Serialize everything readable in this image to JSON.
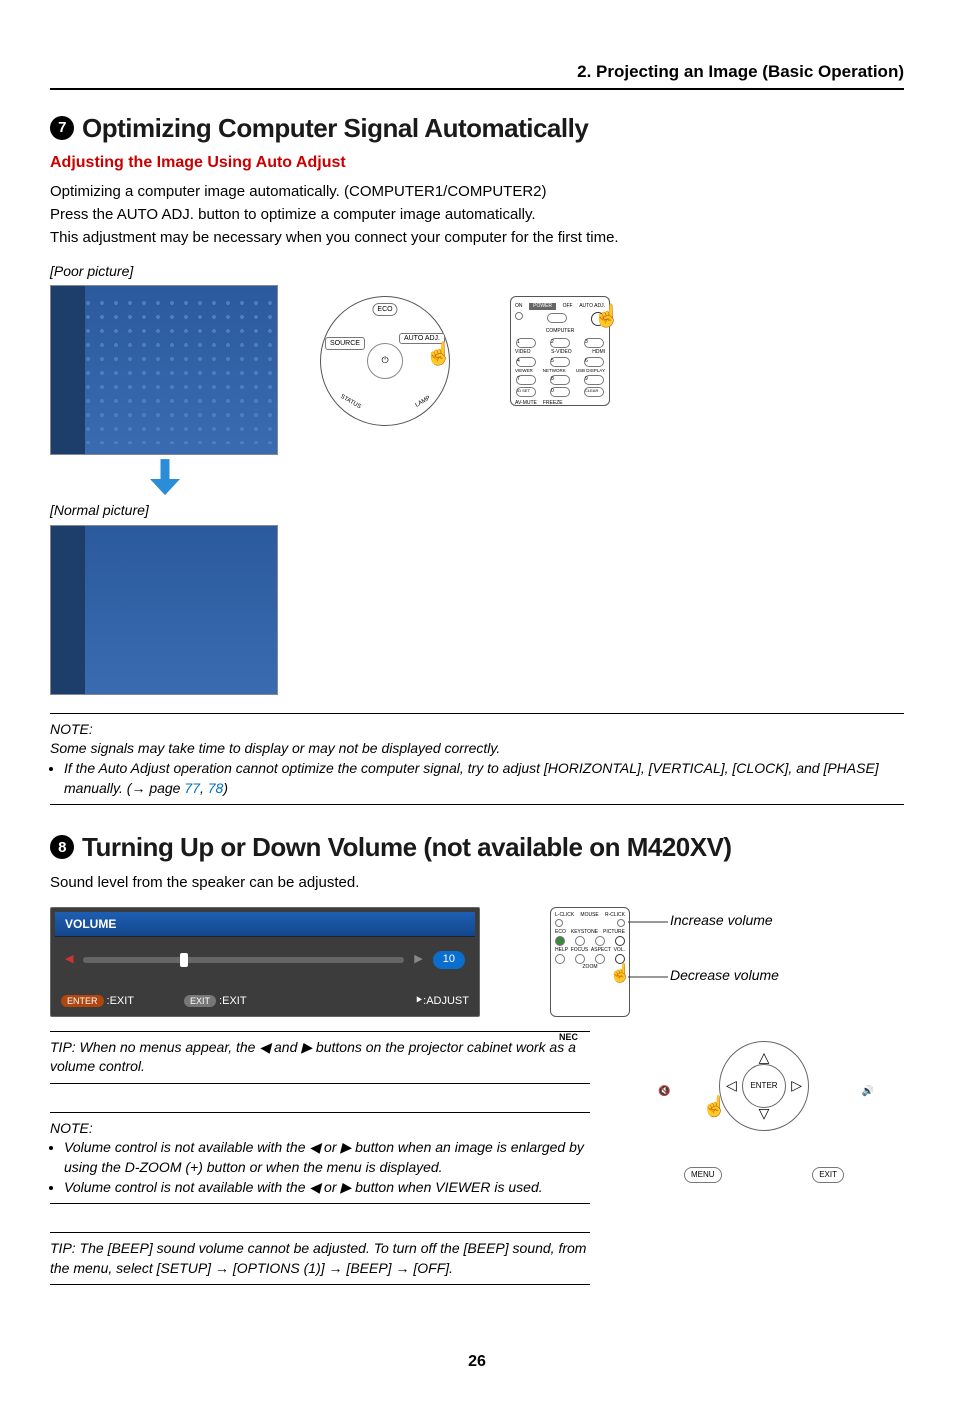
{
  "chapter": "2. Projecting an Image (Basic Operation)",
  "section7": {
    "num": "7",
    "title": "Optimizing Computer Signal Automatically",
    "subtitle": "Adjusting the Image Using Auto Adjust",
    "line1": "Optimizing a computer image automatically. (COMPUTER1/COMPUTER2)",
    "line2": "Press the AUTO ADJ. button to optimize a computer image automatically.",
    "line3": "This adjustment may be necessary when you connect your computer for the first time.",
    "poor_label": "[Poor picture]",
    "normal_label": "[Normal picture]"
  },
  "panel": {
    "eco": "ECO",
    "source": "SOURCE",
    "auto": "AUTO ADJ.",
    "status": "STATUS",
    "lamp": "LAMP"
  },
  "remote1": {
    "on": "ON",
    "power": "POWER",
    "off": "OFF",
    "autoadj": "AUTO ADJ.",
    "computer": "COMPUTER",
    "n1": "1",
    "n2": "2",
    "n3": "3",
    "video": "VIDEO",
    "svideo": "S-VIDEO",
    "hdmi": "HDMI",
    "n4": "4",
    "n5": "5",
    "n6": "6",
    "viewer": "VIEWER",
    "network": "NETWORK",
    "usb": "USB DISPLAY",
    "n7": "7",
    "n8": "8",
    "n9": "9",
    "idset": "ID SET",
    "n0": "0",
    "clear": "CLEAR",
    "avmute": "AV-MUTE",
    "freeze": "FREEZE"
  },
  "note1": {
    "heading": "NOTE:",
    "line1": "Some signals may take time to display or may not be displayed correctly.",
    "bullet1_a": "If the Auto Adjust operation cannot optimize the computer signal, try to adjust [HORIZONTAL], [VERTICAL], [CLOCK], and [PHASE] manually. (",
    "bullet1_b": " page ",
    "link1": "77",
    "sep": ", ",
    "link2": "78",
    "bullet1_c": ")"
  },
  "section8": {
    "num": "8",
    "title": "Turning Up or Down Volume (not available on M420XV)",
    "line1": "Sound level from the speaker can be adjusted."
  },
  "osd": {
    "title": "VOLUME",
    "value": "10",
    "enter": "ENTER",
    "exit": "EXIT",
    "exit_label": ":EXIT",
    "adjust": ":ADJUST"
  },
  "vol_labels": {
    "inc": "Increase volume",
    "dec": "Decrease volume"
  },
  "remote2": {
    "lclick": "L-CLICK",
    "mouse": "MOUSE",
    "rclick": "R-CLICK",
    "eco": "ECO",
    "keystone": "KEYSTONE",
    "picture": "PICTURE",
    "help": "HELP",
    "focus": "FOCUS",
    "aspect": "ASPECT",
    "vol": "VOL.",
    "zoom": "ZOOM",
    "logo": "NEC"
  },
  "tip1_a": "TIP: When no menus appear, the ",
  "tip1_b": " and ",
  "tip1_c": " buttons on the projector cabinet work as a volume control.",
  "note2": {
    "heading": "NOTE:",
    "b1_a": "Volume control is not available with the ",
    "b1_b": " or ",
    "b1_c": " button when an image is enlarged by using the D-ZOOM (+) button or when the menu is displayed.",
    "b2_a": "Volume control is not available with the ",
    "b2_b": " or ",
    "b2_c": " button when VIEWER is used."
  },
  "tip2_a": "TIP: The [BEEP] sound volume cannot be adjusted. To turn off the [BEEP] sound, from the menu, select [SETUP] ",
  "tip2_b": " [OPTIONS (1)] ",
  "tip2_c": " [BEEP] ",
  "tip2_d": " [OFF].",
  "panel_btns": {
    "menu": "MENU",
    "exit": "EXIT",
    "enter": "ENTER"
  },
  "page": "26",
  "glyphs": {
    "left": "◀",
    "right": "▶",
    "arrow": "→",
    "adjust_arrows": "⯈"
  }
}
